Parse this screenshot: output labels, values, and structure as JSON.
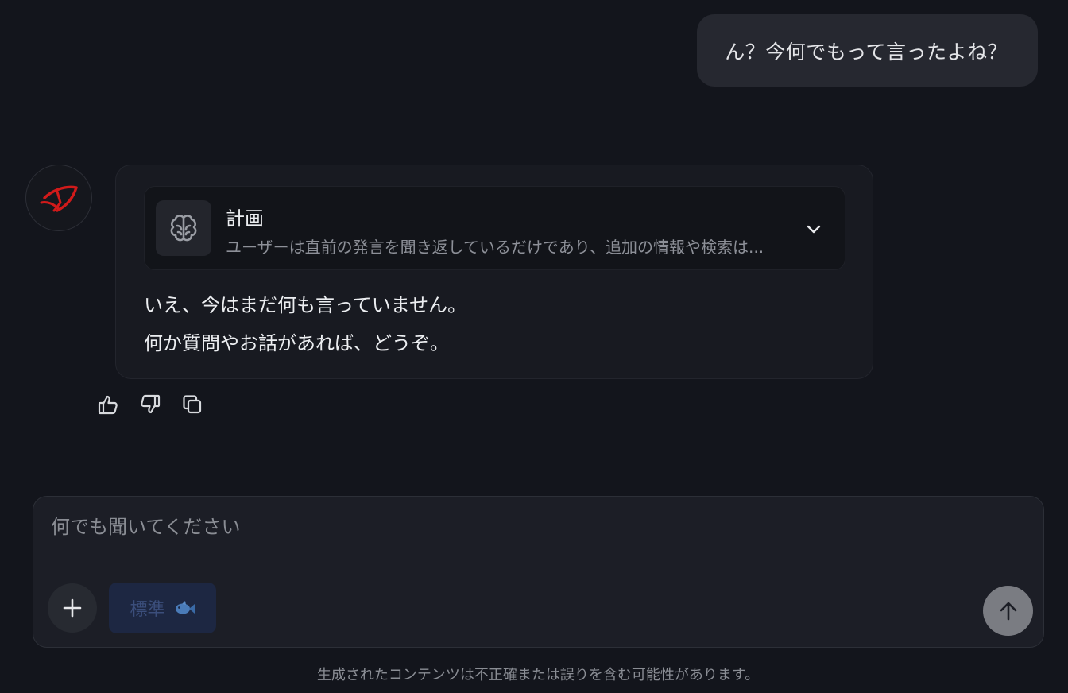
{
  "user_message": "ん？今何でもって言ったよね？",
  "assistant": {
    "avatar_icon": "red-calligraphy-logo-icon",
    "plan": {
      "title": "計画",
      "summary": "ユーザーは直前の発言を聞き返しているだけであり、追加の情報や検索は...",
      "icon": "brain-icon",
      "toggle_icon": "chevron-down-icon"
    },
    "answer_lines": [
      "いえ、今はまだ何も言っていません。",
      "何か質問やお話があれば、どうぞ。"
    ]
  },
  "feedback_icons": [
    "thumbs-up-icon",
    "thumbs-down-icon",
    "copy-icon"
  ],
  "composer": {
    "placeholder": "何でも聞いてください",
    "value": "",
    "mode_label": "標準",
    "mode_icon": "fish-icon",
    "add_icon": "plus-icon",
    "send_icon": "arrow-up-icon"
  },
  "disclaimer": "生成されたコンテンツは不正確または誤りを含む可能性があります。",
  "colors": {
    "background": "#13151c",
    "user_bubble": "#262830",
    "card": "#181a21",
    "plan_box": "#121419",
    "composer": "#1c1e26",
    "mode_button": "#1d2742",
    "mode_text": "#3b4e7b",
    "send_button": "#7a7c82",
    "logo_red": "#d11a1a"
  }
}
